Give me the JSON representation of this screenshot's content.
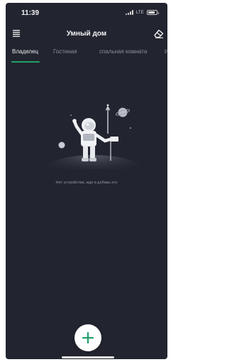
{
  "status_bar": {
    "time": "11:39",
    "network": "LTE",
    "battery_level": 0.85
  },
  "header": {
    "title": "Умный дом",
    "menu_icon": "menu-icon",
    "eraser_icon": "eraser-icon"
  },
  "tabs": [
    {
      "label": "Владелец",
      "active": true
    },
    {
      "label": "Гостиная",
      "active": false
    },
    {
      "label": "спальная комната",
      "active": false
    },
    {
      "label": "И",
      "active": false
    }
  ],
  "empty_state": {
    "message": "Нет устройства, иди и добавь его",
    "illustration": "astronaut-illustration"
  },
  "fab": {
    "icon": "plus-icon",
    "color": "#21a06a"
  },
  "colors": {
    "background": "#22252f",
    "accent": "#21a06a",
    "tab_inactive": "#8a8f9b"
  }
}
